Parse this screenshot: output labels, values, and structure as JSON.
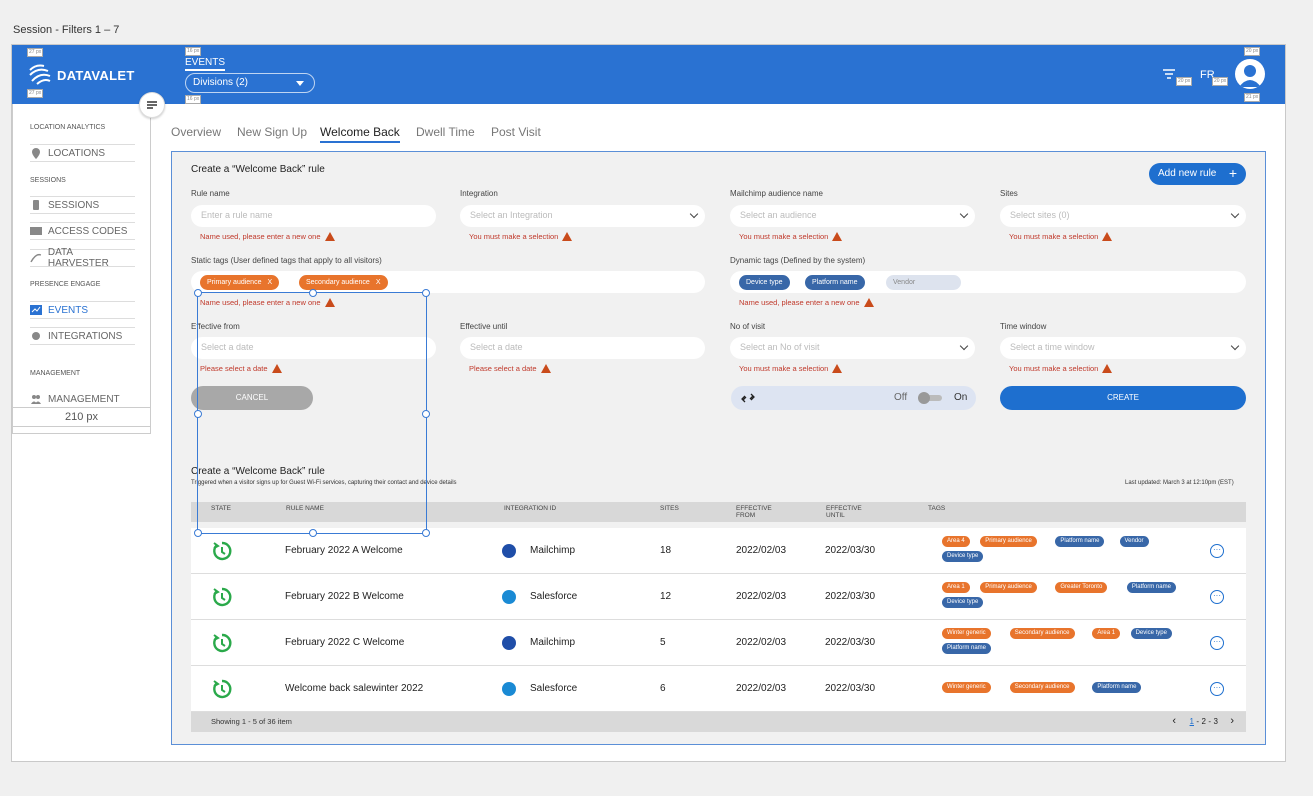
{
  "frame_title": "Session - Filters 1 – 7",
  "brand": {
    "name": "DATAVALET",
    "accent": "#2a72d2"
  },
  "header": {
    "events_label": "EVENTS",
    "divisions": "Divisions (2)",
    "lang": "FR"
  },
  "sidebar": {
    "width_label": "210 px",
    "sections": [
      {
        "label": "LOCATION ANALYTICS"
      },
      {
        "label": "SESSIONS"
      },
      {
        "label": "PRESENCE ENGAGE"
      },
      {
        "label": "MANAGEMENT"
      }
    ],
    "items": [
      {
        "label": "LOCATIONS",
        "icon": "location-pin-icon"
      },
      {
        "label": "SESSIONS",
        "icon": "phone-icon"
      },
      {
        "label": "ACCESS CODES",
        "icon": "code-123-icon"
      },
      {
        "label": "DATA HARVESTER",
        "icon": "harvester-icon"
      },
      {
        "label": "EVENTS",
        "icon": "chart-icon"
      },
      {
        "label": "INTEGRATIONS",
        "icon": "puzzle-icon"
      },
      {
        "label": "MANAGEMENT",
        "icon": "users-icon"
      }
    ]
  },
  "tabs": [
    "Overview",
    "New Sign Up",
    "Welcome Back",
    "Dwell Time",
    "Post Visit"
  ],
  "form": {
    "title": "Create a “Welcome Back” rule",
    "add_rule": "Add new rule",
    "rule_name": {
      "label": "Rule name",
      "placeholder": "Enter a rule name",
      "error": "Name used, please enter a new one"
    },
    "integration": {
      "label": "Integration",
      "placeholder": "Select an Integration",
      "error": "You must make a selection"
    },
    "mailchimp": {
      "label": "Mailchimp audience name",
      "placeholder": "Select an audience",
      "error": "You must make a selection"
    },
    "sites": {
      "label": "Sites",
      "placeholder": "Select sites (0)",
      "error": "You must make a selection"
    },
    "static_tags": {
      "label": "Static tags (User defined tags that apply to all visitors)",
      "chips": [
        "Primary audience",
        "Secondary audience"
      ],
      "error": "Name used, please enter a new one"
    },
    "dynamic_tags": {
      "label": "Dynamic tags (Defined by the system)",
      "chips": [
        "Device type",
        "Platform name"
      ],
      "grey_chip": "Vendor",
      "error": "Name used, please enter a new one"
    },
    "effective_from": {
      "label": "Effective from",
      "placeholder": "Select a date",
      "error": "Please select a date"
    },
    "effective_until": {
      "label": "Effective until",
      "placeholder": "Select a date",
      "error": "Please select a date"
    },
    "no_visit": {
      "label": "No of visit",
      "placeholder": "Select an No of visit",
      "error": "You must make a selection"
    },
    "time_window": {
      "label": "Time window",
      "placeholder": "Select a time window",
      "error": "You must make a selection"
    },
    "cancel": "CANCEL",
    "create": "CREATE",
    "toggle_off": "Off",
    "toggle_on": "On"
  },
  "table": {
    "title": "Create a “Welcome Back” rule",
    "subtitle": "Triggered when a visitor signs up for Guest Wi-Fi services, capturing their contact and device details",
    "last_updated": "Last updated: March 3 at 12:10pm (EST)",
    "columns": [
      "STATE",
      "RULE NAME",
      "INTEGRATION ID",
      "SITES",
      "EFFECTIVE FROM",
      "EFFECTIVE UNTIL",
      "TAGS"
    ],
    "rows": [
      {
        "name": "February 2022 A Welcome",
        "integration": "Mailchimp",
        "sites": "18",
        "from": "2022/02/03",
        "until": "2022/03/30",
        "tags": [
          {
            "t": "Area 4",
            "c": "o"
          },
          {
            "t": "Primary audience",
            "c": "o"
          },
          {
            "t": "Platform name",
            "c": "b"
          },
          {
            "t": "Vendor",
            "c": "b"
          },
          {
            "t": "Device type",
            "c": "b"
          }
        ]
      },
      {
        "name": "February 2022 B Welcome",
        "integration": "Salesforce",
        "sites": "12",
        "from": "2022/02/03",
        "until": "2022/03/30",
        "tags": [
          {
            "t": "Area 1",
            "c": "o"
          },
          {
            "t": "Primary audience",
            "c": "o"
          },
          {
            "t": "Greater Toronto",
            "c": "o"
          },
          {
            "t": "Platform name",
            "c": "b"
          },
          {
            "t": "Device type",
            "c": "b"
          }
        ]
      },
      {
        "name": "February 2022 C Welcome",
        "integration": "Mailchimp",
        "sites": "5",
        "from": "2022/02/03",
        "until": "2022/03/30",
        "tags": [
          {
            "t": "Winter generic",
            "c": "o"
          },
          {
            "t": "Secondary audience",
            "c": "o"
          },
          {
            "t": "Area 1",
            "c": "o"
          },
          {
            "t": "Device type",
            "c": "b"
          },
          {
            "t": "Platform name",
            "c": "b"
          }
        ]
      },
      {
        "name": "Welcome back salewinter 2022",
        "integration": "Salesforce",
        "sites": "6",
        "from": "2022/02/03",
        "until": "2022/03/30",
        "tags": [
          {
            "t": "Winter generic",
            "c": "o"
          },
          {
            "t": "Secondary audience",
            "c": "o"
          },
          {
            "t": "Platform name",
            "c": "b"
          }
        ]
      }
    ],
    "footer": "Showing 1 - 5 of 36 item",
    "pages": [
      "1",
      "2",
      "3"
    ]
  }
}
